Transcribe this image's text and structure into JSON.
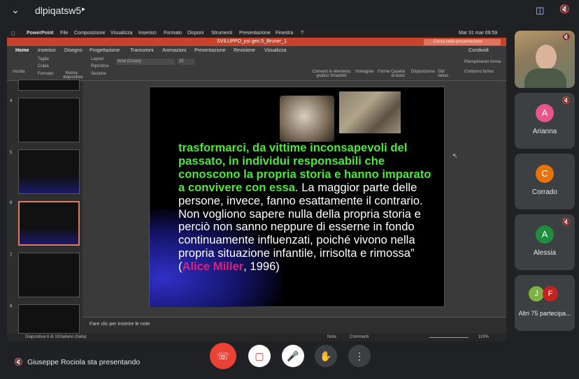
{
  "meeting": {
    "title": "dlpiqatsw5",
    "presenting_text": "Giuseppe Rociola sta presentando"
  },
  "participants": [
    {
      "initial": "A",
      "name": "Arianna",
      "color": "#e8558a"
    },
    {
      "initial": "C",
      "name": "Corrado",
      "color": "#e8710a"
    },
    {
      "initial": "A",
      "name": "Alessia",
      "color": "#1e8e3e"
    }
  ],
  "others": {
    "initials": [
      "J",
      "F"
    ],
    "label": "Altri 75 partecipa..."
  },
  "mac_menu": {
    "app": "PowerPoint",
    "items": [
      "File",
      "Composizione",
      "Visualizza",
      "Inserisci",
      "Formato",
      "Disponi",
      "Strumenti",
      "Presentazione",
      "Finestra",
      "?"
    ],
    "clock": "Mar 31 mar  09:59"
  },
  "ppt": {
    "doc_title": "SVILUPPO_psi gen.5_Bruner_1",
    "search_placeholder": "Cerca nella presentazione",
    "tabs": [
      "Home",
      "Inserisci",
      "Disegno",
      "Progettazione",
      "Transizioni",
      "Animazioni",
      "Presentazione",
      "Revisione",
      "Visualizza"
    ],
    "share": "Condividi",
    "toolbar": {
      "paste": "Incolla",
      "cut": "Taglia",
      "copy": "Copia",
      "format": "Formato",
      "new_slide": "Nuova diapositiva",
      "layout": "Layout",
      "reset": "Ripristina",
      "section": "Sezione",
      "font": "Arial (Corpo)",
      "size": "32",
      "smartart": "Converti in elemento grafico SmartArt",
      "image": "Immagine",
      "shapes": "Forme",
      "textbox": "Casella di testo",
      "arrange": "Disposizione",
      "styles": "Stili veloci",
      "fill": "Riempimento forma",
      "outline": "Contorno forma"
    },
    "thumb_numbers": [
      "4",
      "5",
      "6",
      "7",
      "8"
    ],
    "notes_placeholder": "Fare clic per inserire le note",
    "status": {
      "slide": "Diapositiva 6 di 19",
      "lang": "Italiano (Italia)",
      "notes": "Nota",
      "comments": "Commenti",
      "zoom": "119%"
    }
  },
  "slide": {
    "green_text": "trasformarci, da vittime inconsapevoli del passato, in individui responsabili che conoscono la propria storia e hanno imparato a convivere con essa",
    "body_text": ". La maggior parte delle persone, invece, fanno esattamente il contrario. Non vogliono sapere nulla della propria storia e perciò non sanno neppure di esserne in fondo continuamente influenzati, poiché vivono nella propria situazione infantile, irrisolta e rimossa” (",
    "author": "Alice Miller",
    "year": ", 1996)"
  }
}
